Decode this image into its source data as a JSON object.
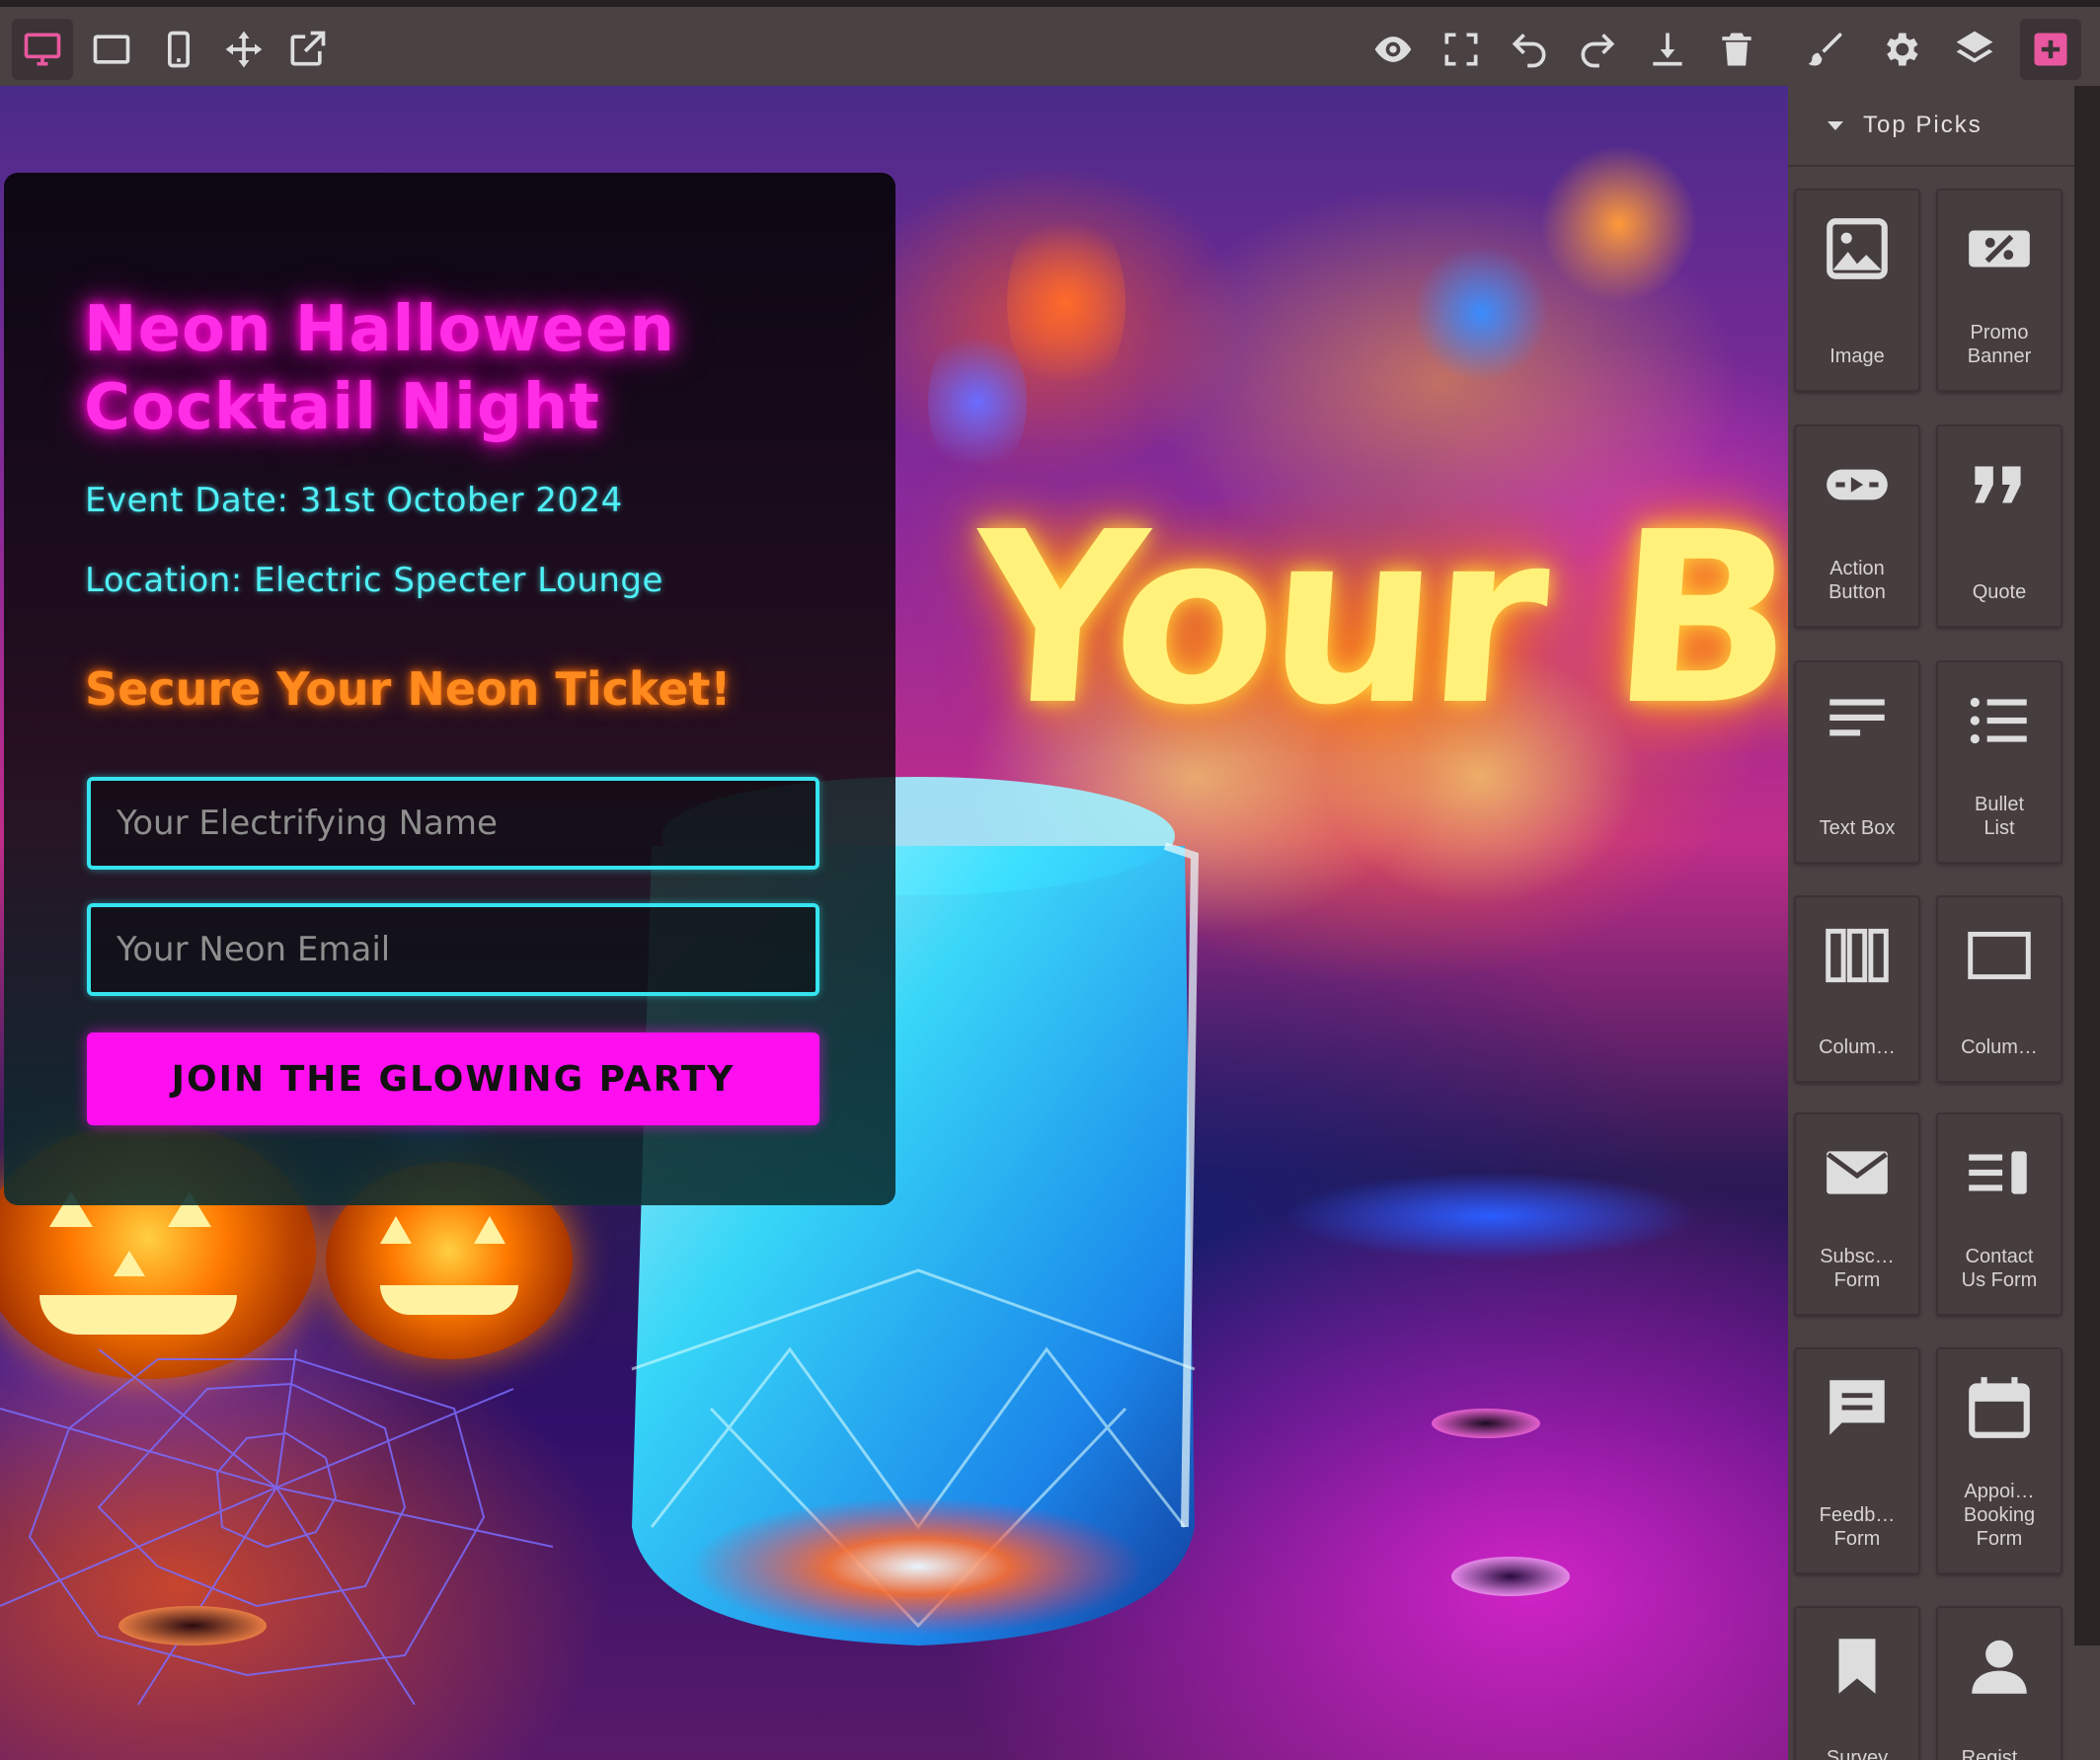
{
  "toolbar": {
    "left_tools": [
      "desktop-view-icon",
      "tablet-view-icon",
      "mobile-view-icon",
      "move-icon",
      "open-external-icon"
    ],
    "right_tools": [
      "preview-eye-icon",
      "fullscreen-icon",
      "undo-icon",
      "redo-icon",
      "download-icon",
      "trash-icon",
      "brush-icon",
      "settings-gear-icon",
      "layers-icon",
      "add-block-icon"
    ],
    "accent_color": "#e8579f"
  },
  "card": {
    "title": "Neon Halloween Cocktail Night",
    "event_date": "Event Date: 31st October 2024",
    "location": "Location: Electric Specter Lounge",
    "cta_heading": "Secure Your Neon Ticket!",
    "name_placeholder": "Your Electrifying Name",
    "email_placeholder": "Your Neon Email",
    "button_label": "JOIN THE GLOWING PARTY",
    "colors": {
      "title": "#ff2ee6",
      "info": "#4ff0f6",
      "cta": "#ff8a1e",
      "button": "#ff0ff0"
    }
  },
  "background": {
    "sign_text": "Your Bran"
  },
  "panel": {
    "title": "Top Picks",
    "blocks": [
      {
        "label": "Image",
        "icon": "image-icon"
      },
      {
        "label": "Promo\nBanner",
        "icon": "promo-banner-icon"
      },
      {
        "label": "Action\nButton",
        "icon": "action-button-icon"
      },
      {
        "label": "Quote",
        "icon": "quote-icon"
      },
      {
        "label": "Text Box",
        "icon": "text-box-icon"
      },
      {
        "label": "Bullet\nList",
        "icon": "bullet-list-icon"
      },
      {
        "label": "Colum…",
        "icon": "three-columns-icon"
      },
      {
        "label": "Colum…",
        "icon": "one-column-icon"
      },
      {
        "label": "Subsc…\nForm",
        "icon": "envelope-icon"
      },
      {
        "label": "Contact\nUs Form",
        "icon": "contact-form-icon"
      },
      {
        "label": "Feedb…\nForm",
        "icon": "feedback-icon"
      },
      {
        "label": "Appoi…\nBooking\nForm",
        "icon": "calendar-icon"
      },
      {
        "label": "Survey",
        "icon": "bookmark-icon"
      },
      {
        "label": "Regist…",
        "icon": "person-icon"
      }
    ]
  }
}
